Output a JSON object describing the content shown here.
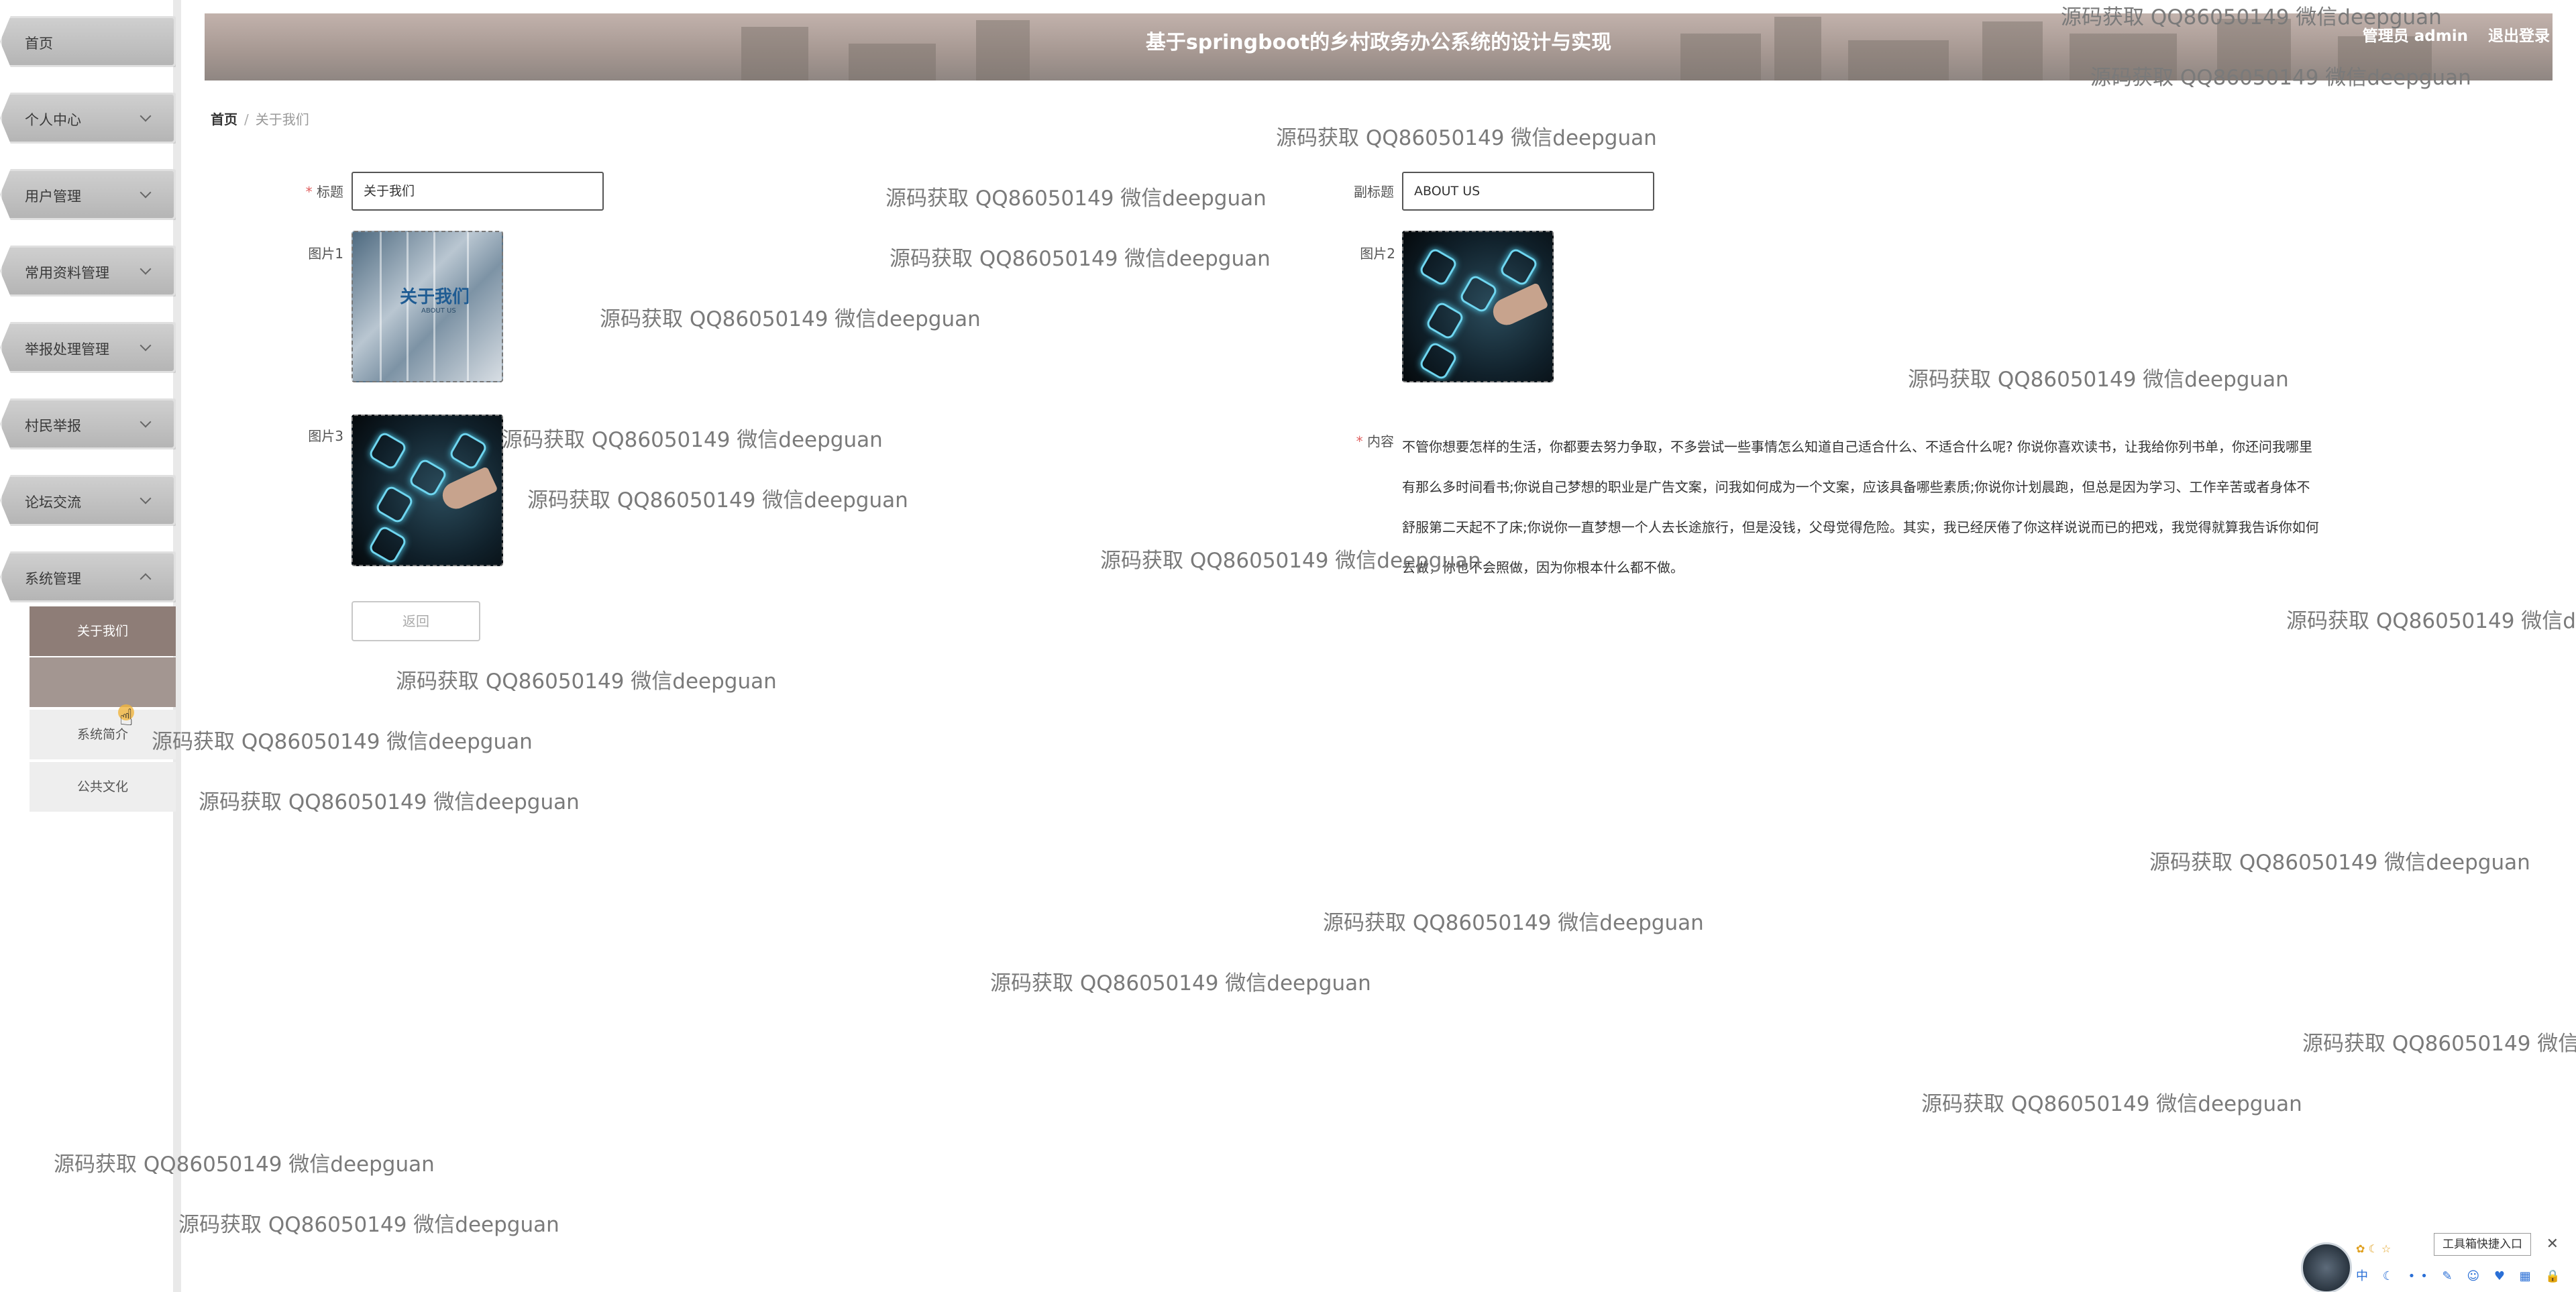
{
  "header": {
    "title": "基于springboot的乡村政务办公系统的设计与实现",
    "user": "管理员 admin",
    "logout": "退出登录"
  },
  "sidebar": {
    "items": [
      {
        "label": "首页",
        "expandable": false
      },
      {
        "label": "个人中心",
        "expandable": true
      },
      {
        "label": "用户管理",
        "expandable": true
      },
      {
        "label": "常用资料管理",
        "expandable": true
      },
      {
        "label": "举报处理管理",
        "expandable": true
      },
      {
        "label": "村民举报",
        "expandable": true
      },
      {
        "label": "论坛交流",
        "expandable": true
      },
      {
        "label": "系统管理",
        "expandable": true,
        "expanded": true
      }
    ],
    "subitems": [
      {
        "label": "关于我们",
        "state": "active"
      },
      {
        "label": "",
        "state": "hover"
      },
      {
        "label": "系统简介",
        "state": "normal"
      },
      {
        "label": "公共文化",
        "state": "normal"
      }
    ]
  },
  "breadcrumb": {
    "home": "首页",
    "current": "关于我们"
  },
  "form": {
    "title_label": "标题",
    "title_value": "关于我们",
    "subtitle_label": "副标题",
    "subtitle_value": "ABOUT US",
    "pic1_label": "图片1",
    "pic2_label": "图片2",
    "pic3_label": "图片3",
    "content_label": "内容",
    "content_text": "不管你想要怎样的生活，你都要去努力争取，不多尝试一些事情怎么知道自己适合什么、不适合什么呢? 你说你喜欢读书，让我给你列书单，你还问我哪里有那么多时间看书;你说自己梦想的职业是广告文案，问我如何成为一个文案，应该具备哪些素质;你说你计划晨跑，但总是因为学习、工作辛苦或者身体不舒服第二天起不了床;你说你一直梦想一个人去长途旅行，但是没钱，父母觉得危险。其实，我已经厌倦了你这样说说而已的把戏，我觉得就算我告诉你如何去做，你也不会照做，因为你根本什么都不做。",
    "back_button": "返回",
    "pic1_text": "关于我们",
    "pic1_subtext": "ABOUT US"
  },
  "watermark": {
    "text": "源码获取 QQ86050149 微信deepguan"
  },
  "widget": {
    "entry_label": "工具箱快捷入口",
    "close": "✕",
    "tools": "中 ☾ •• ✎ ☺ ♥ ▦ 🔒"
  },
  "colors": {
    "active_menu": "#8e7d77",
    "header": "#a59791",
    "required": "#e06060"
  }
}
